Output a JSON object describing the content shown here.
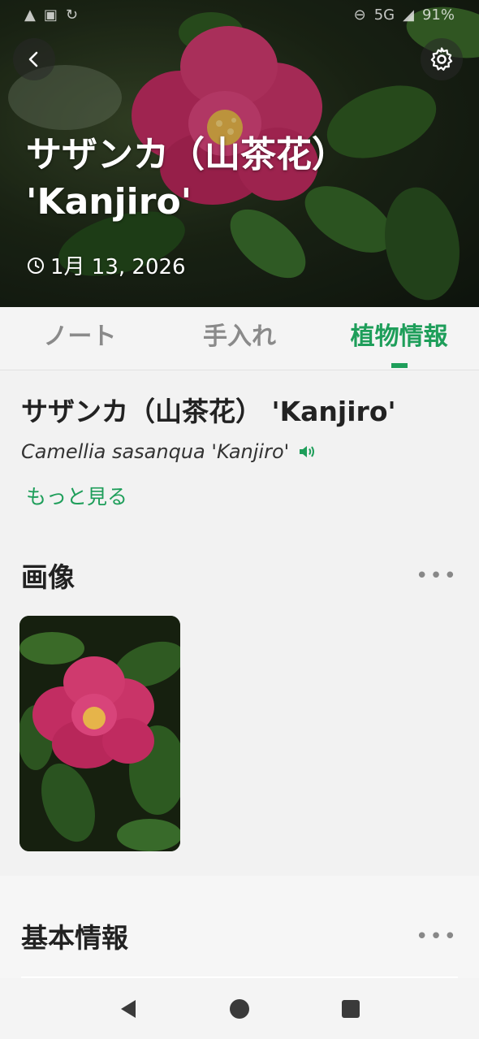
{
  "status_bar": {
    "network": "5G",
    "battery": "91%"
  },
  "header": {
    "plant_title": "サザンカ（山茶花） 'Kanjiro'",
    "date": "1月 13, 2026",
    "icons": [
      "back-arrow-icon",
      "gear-icon",
      "clock-icon"
    ]
  },
  "tabs": [
    {
      "label": "ノート",
      "active": false
    },
    {
      "label": "手入れ",
      "active": false
    },
    {
      "label": "植物情報",
      "active": true
    }
  ],
  "plant_info": {
    "name": "サザンカ（山茶花） 'Kanjiro'",
    "scientific_name": "Camellia sasanqua 'Kanjiro'",
    "more_link": "もっと見る"
  },
  "sections": {
    "images_title": "画像",
    "basic_info_title": "基本情報",
    "more_menu": "•••"
  },
  "colors": {
    "accent": "#1e9e5a",
    "flower": "#d0336a"
  }
}
